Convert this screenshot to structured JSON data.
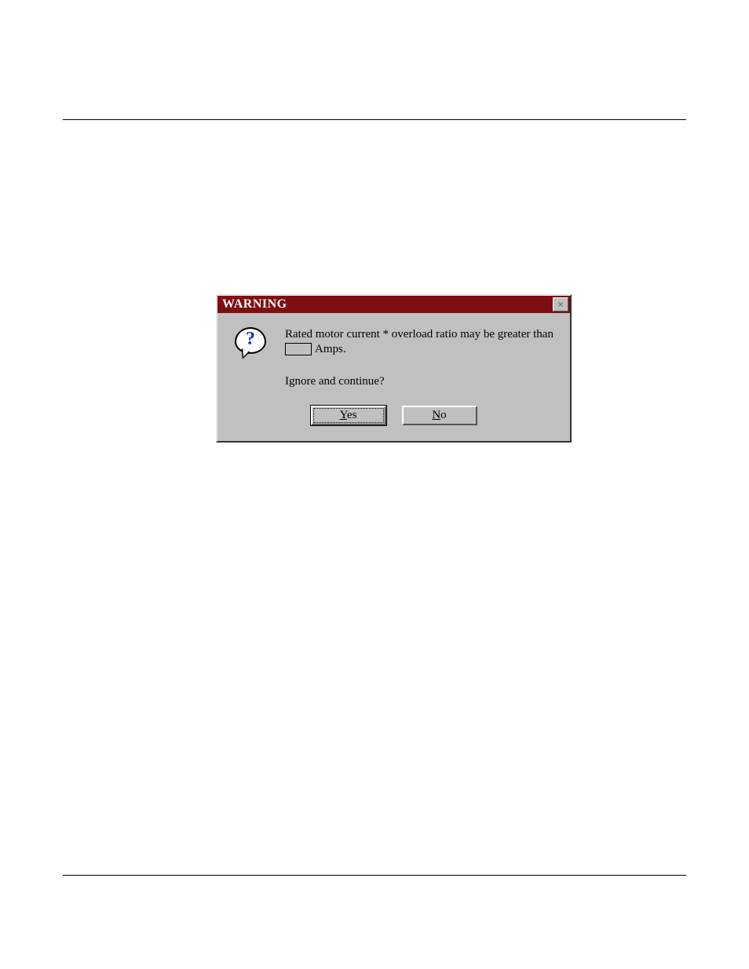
{
  "dialog": {
    "title": "WARNING",
    "close_glyph": "×",
    "icon_glyph": "?",
    "message_line1": "Rated motor current * overload ratio may be greater than",
    "amps_suffix": "Amps.",
    "message_line3": "Ignore and continue?",
    "yes_prefix": "Y",
    "yes_rest": "es",
    "no_prefix": "N",
    "no_rest": "o"
  }
}
